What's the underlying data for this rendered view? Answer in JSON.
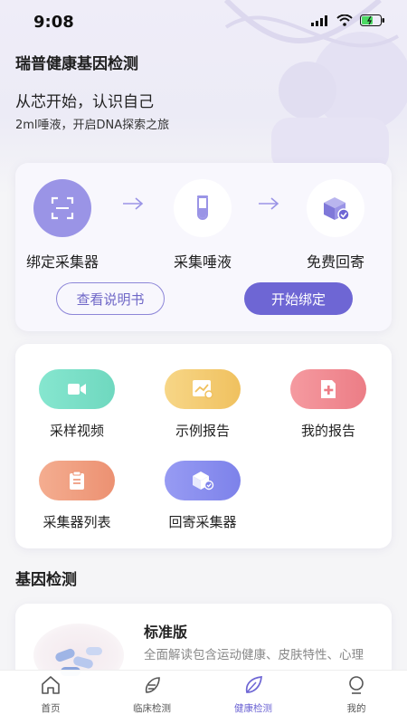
{
  "status": {
    "time": "9:08"
  },
  "header": {
    "title": "瑞普健康基因检测",
    "slogan": "从芯开始，认识自己",
    "sub": "2ml唾液，开启DNA探索之旅"
  },
  "steps": [
    {
      "label": "绑定采集器",
      "icon": "scan-icon"
    },
    {
      "label": "采集唾液",
      "icon": "test-tube-icon"
    },
    {
      "label": "免费回寄",
      "icon": "return-box-icon"
    }
  ],
  "buttons": {
    "manual": "查看说明书",
    "start_bind": "开始绑定"
  },
  "functions": [
    {
      "label": "采样视频",
      "icon": "video-icon",
      "color": "#7ee0c8"
    },
    {
      "label": "示例报告",
      "icon": "report-chart-icon",
      "color": "#f5cd78"
    },
    {
      "label": "我的报告",
      "icon": "medical-report-icon",
      "color": "#f28b93"
    },
    {
      "label": "采集器列表",
      "icon": "clipboard-icon",
      "color": "#f0a184"
    },
    {
      "label": "回寄采集器",
      "icon": "box-check-icon",
      "color": "#8b8fef"
    }
  ],
  "section": {
    "title": "基因检测"
  },
  "product": {
    "name": "标准版",
    "desc": "全面解读包含运动健康、皮肤特性、心理"
  },
  "tabs": [
    {
      "label": "首页",
      "icon": "home-icon"
    },
    {
      "label": "临床检测",
      "icon": "clinical-icon"
    },
    {
      "label": "健康检测",
      "icon": "leaf-icon",
      "active": true
    },
    {
      "label": "我的",
      "icon": "profile-icon"
    }
  ],
  "colors": {
    "accent": "#6e66d4",
    "accent_light": "#9a94e6"
  }
}
